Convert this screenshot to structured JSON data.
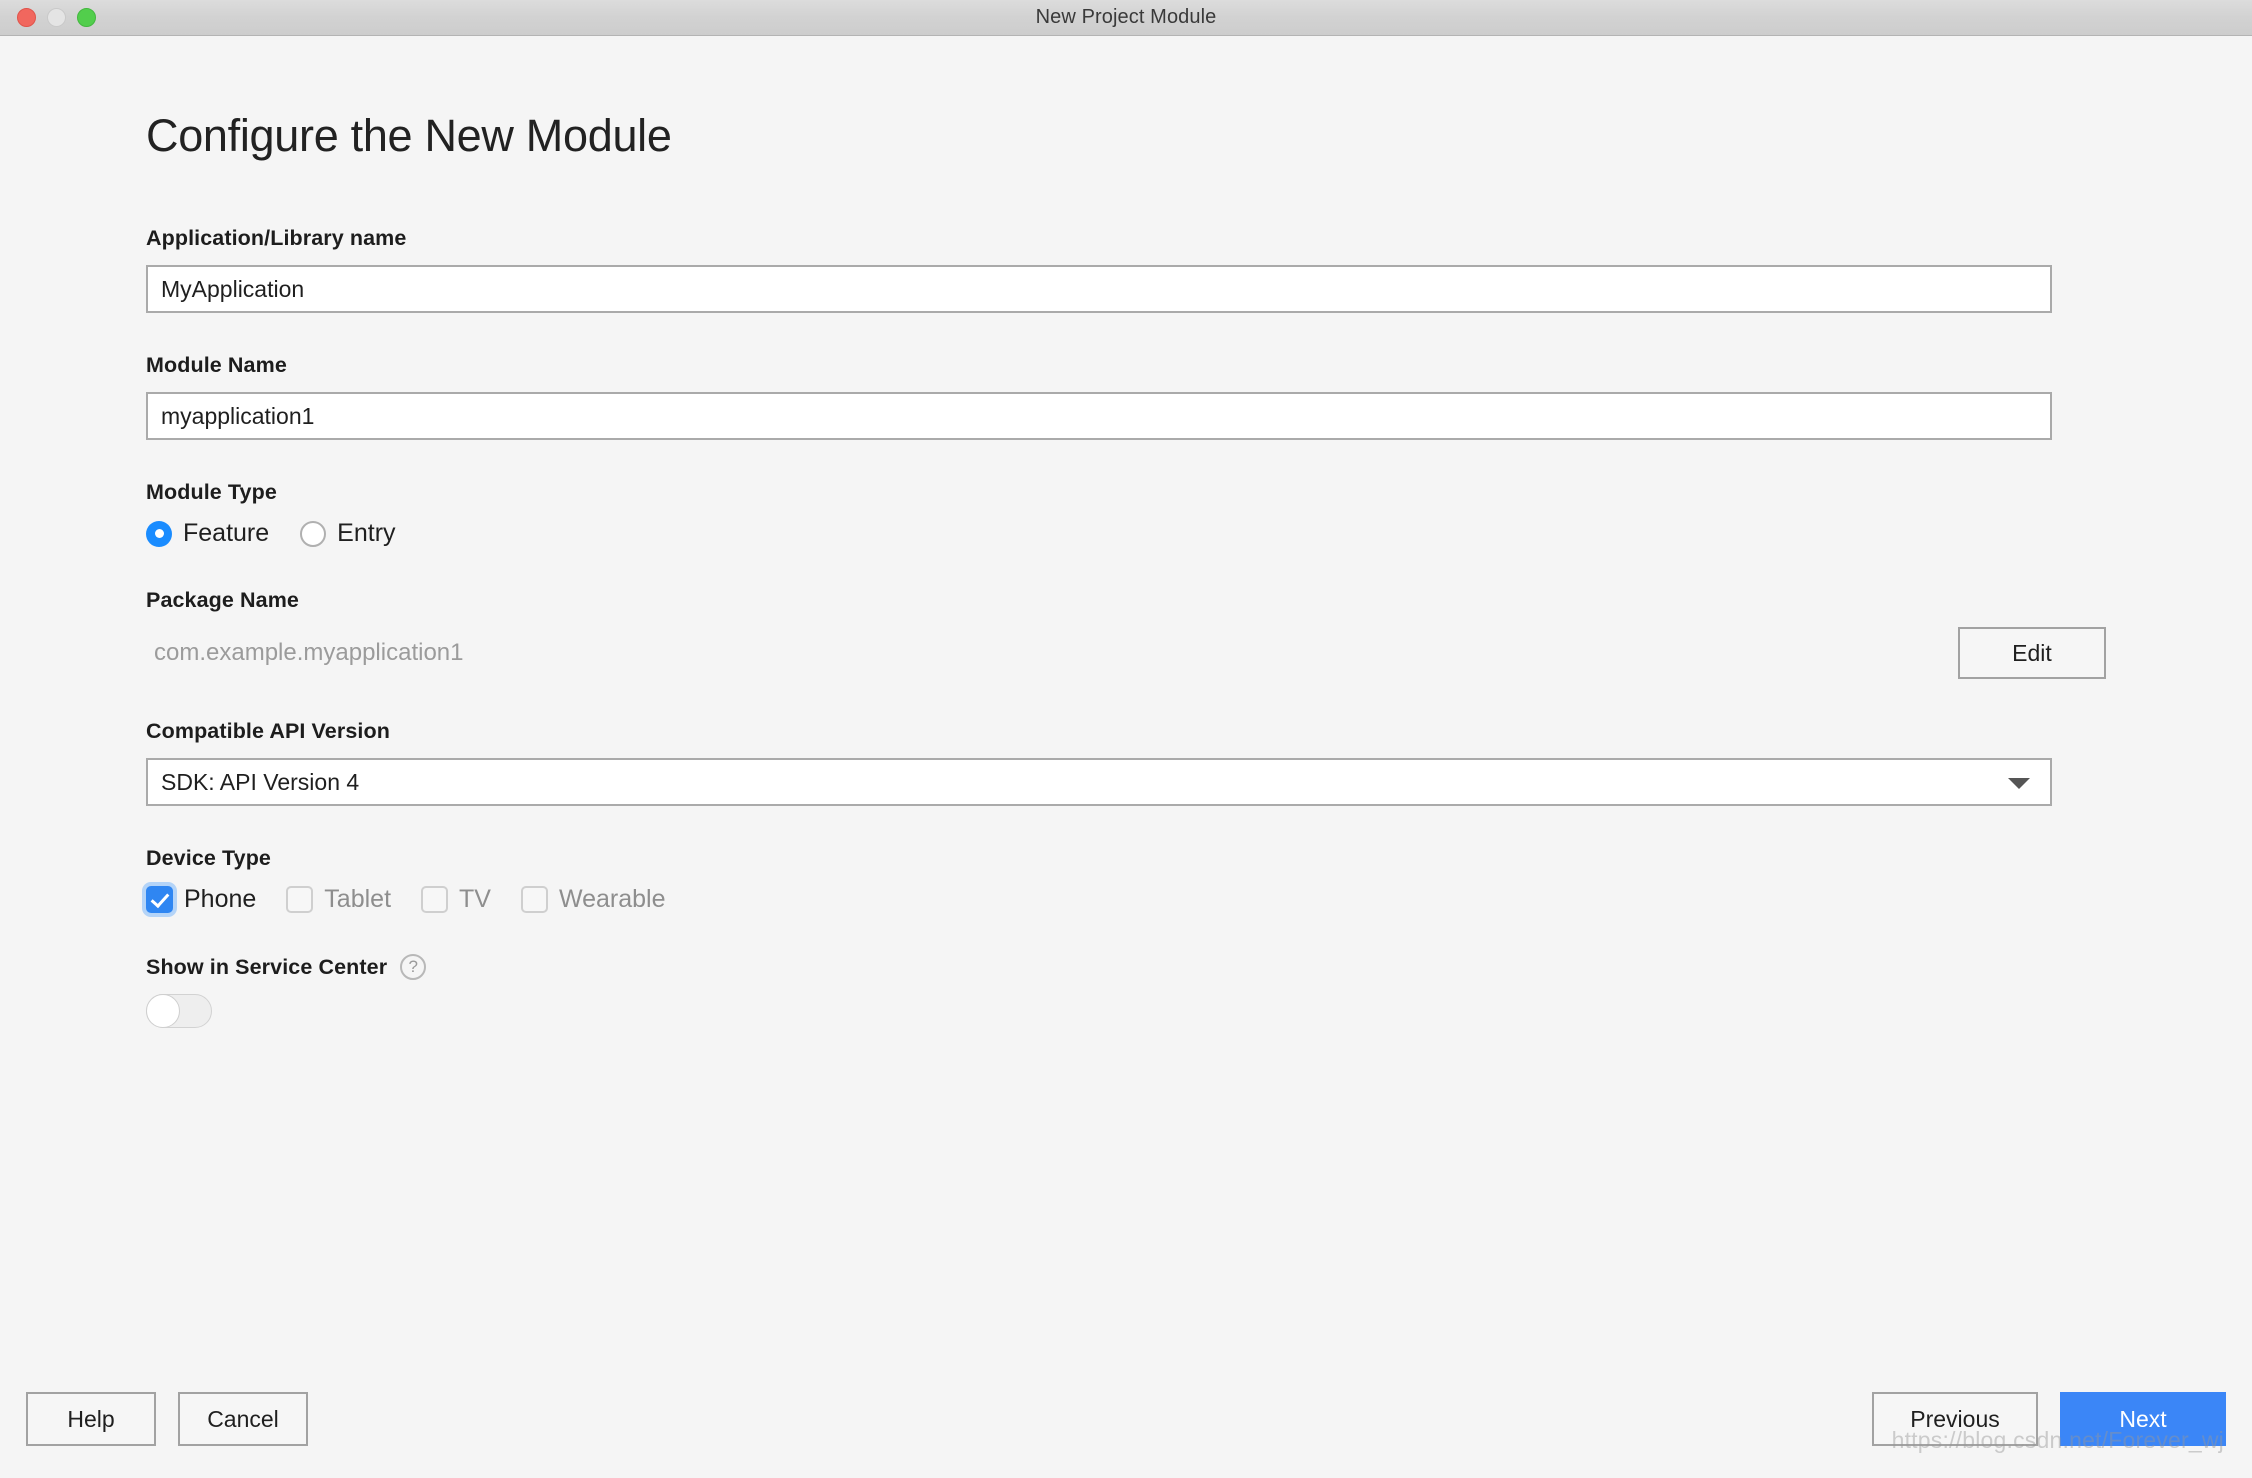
{
  "window": {
    "title": "New Project Module",
    "traffic_lights": [
      "close-button",
      "minimize-button",
      "zoom-button"
    ]
  },
  "page": {
    "heading": "Configure the New Module"
  },
  "app_name": {
    "label": "Application/Library name",
    "value": "MyApplication",
    "placeholder": "Application/Library name"
  },
  "module_name": {
    "label": "Module Name",
    "value": "myapplication1",
    "placeholder": "Module Name"
  },
  "module_type": {
    "label": "Module Type",
    "selected": "Feature",
    "options": [
      {
        "label": "Feature",
        "selected": true
      },
      {
        "label": "Entry",
        "selected": false
      }
    ]
  },
  "package_name": {
    "label": "Package Name",
    "value": "com.example.myapplication1",
    "edit_label": "Edit"
  },
  "api_version": {
    "label": "Compatible API Version",
    "selected": "SDK: API Version 4",
    "arrow_icon": "chevron-down-icon"
  },
  "device_type": {
    "label": "Device Type",
    "options": [
      {
        "label": "Phone",
        "checked": true,
        "enabled": true
      },
      {
        "label": "Tablet",
        "checked": false,
        "enabled": false
      },
      {
        "label": "TV",
        "checked": false,
        "enabled": false
      },
      {
        "label": "Wearable",
        "checked": false,
        "enabled": false
      }
    ]
  },
  "service_center": {
    "label": "Show in Service Center",
    "help_icon": "question-mark-icon",
    "help_glyph": "?",
    "toggle_state": "off"
  },
  "footer": {
    "help_label": "Help",
    "cancel_label": "Cancel",
    "previous_label": "Previous",
    "next_label": "Next"
  },
  "watermark": {
    "text": "https://blog.csdn.net/Forever_wj"
  },
  "colors": {
    "accent_blue": "#3b86f7",
    "radio_blue": "#1a8cff",
    "checkbox_blue": "#2f86f2",
    "window_bg": "#f5f5f5",
    "titlebar_bg": "#d4d4d4",
    "close_red": "#f1675e",
    "zoom_green": "#52ce4c"
  }
}
